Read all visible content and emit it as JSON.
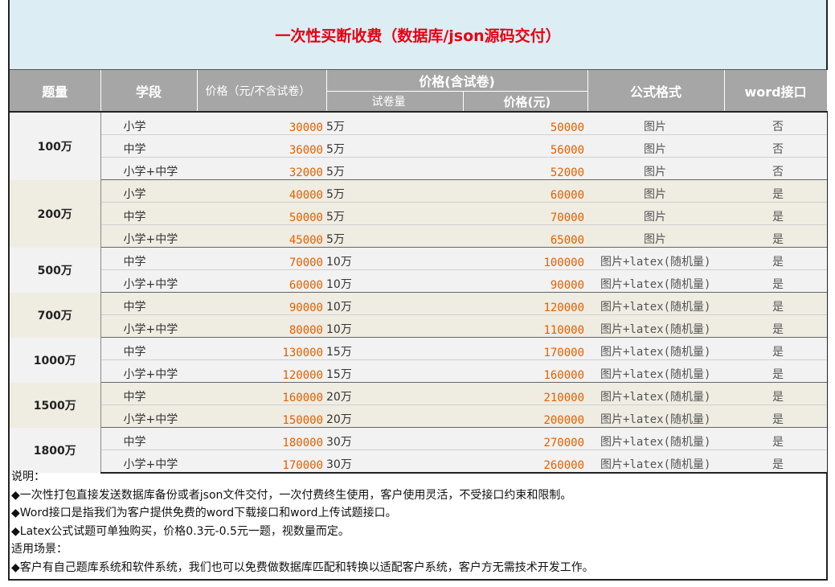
{
  "title": "一次性买断收费（数据库/json源码交付）",
  "headers": {
    "qty": "题量",
    "stage": "学段",
    "price_ex": "价格（元/不含试卷）",
    "price_inc": "价格(含试卷)",
    "papers": "试卷量",
    "price": "价格(元)",
    "formula": "公式格式",
    "word": "word接口"
  },
  "groups": [
    {
      "qty": "100万",
      "rows": [
        {
          "stage": "小学",
          "p1": "30000",
          "cnt": "5万",
          "p2": "50000",
          "fmt": "图片",
          "word": "否"
        },
        {
          "stage": "中学",
          "p1": "36000",
          "cnt": "5万",
          "p2": "56000",
          "fmt": "图片",
          "word": "否"
        },
        {
          "stage": "小学+中学",
          "p1": "32000",
          "cnt": "5万",
          "p2": "52000",
          "fmt": "图片",
          "word": "否"
        }
      ]
    },
    {
      "qty": "200万",
      "rows": [
        {
          "stage": "小学",
          "p1": "40000",
          "cnt": "5万",
          "p2": "60000",
          "fmt": "图片",
          "word": "是"
        },
        {
          "stage": "中学",
          "p1": "50000",
          "cnt": "5万",
          "p2": "70000",
          "fmt": "图片",
          "word": "是"
        },
        {
          "stage": "小学+中学",
          "p1": "45000",
          "cnt": "5万",
          "p2": "65000",
          "fmt": "图片",
          "word": "是"
        }
      ]
    },
    {
      "qty": "500万",
      "rows": [
        {
          "stage": "中学",
          "p1": "70000",
          "cnt": "10万",
          "p2": "100000",
          "fmt": "图片+latex(随机量)",
          "word": "是"
        },
        {
          "stage": "小学+中学",
          "p1": "60000",
          "cnt": "10万",
          "p2": "90000",
          "fmt": "图片+latex(随机量)",
          "word": "是"
        }
      ]
    },
    {
      "qty": "700万",
      "rows": [
        {
          "stage": "中学",
          "p1": "90000",
          "cnt": "10万",
          "p2": "120000",
          "fmt": "图片+latex(随机量)",
          "word": "是"
        },
        {
          "stage": "小学+中学",
          "p1": "80000",
          "cnt": "10万",
          "p2": "110000",
          "fmt": "图片+latex(随机量)",
          "word": "是"
        }
      ]
    },
    {
      "qty": "1000万",
      "rows": [
        {
          "stage": "中学",
          "p1": "130000",
          "cnt": "15万",
          "p2": "170000",
          "fmt": "图片+latex(随机量)",
          "word": "是"
        },
        {
          "stage": "小学+中学",
          "p1": "120000",
          "cnt": "15万",
          "p2": "160000",
          "fmt": "图片+latex(随机量)",
          "word": "是"
        }
      ]
    },
    {
      "qty": "1500万",
      "rows": [
        {
          "stage": "中学",
          "p1": "160000",
          "cnt": "20万",
          "p2": "210000",
          "fmt": "图片+latex(随机量)",
          "word": "是"
        },
        {
          "stage": "小学+中学",
          "p1": "150000",
          "cnt": "20万",
          "p2": "200000",
          "fmt": "图片+latex(随机量)",
          "word": "是"
        }
      ]
    },
    {
      "qty": "1800万",
      "rows": [
        {
          "stage": "中学",
          "p1": "180000",
          "cnt": "30万",
          "p2": "270000",
          "fmt": "图片+latex(随机量)",
          "word": "是"
        },
        {
          "stage": "小学+中学",
          "p1": "170000",
          "cnt": "30万",
          "p2": "260000",
          "fmt": "图片+latex(随机量)",
          "word": "是"
        }
      ]
    }
  ],
  "notes": [
    "说明：",
    "◆一次性打包直接发送数据库备份或者json文件交付，一次付费终生使用，客户使用灵活，不受接口约束和限制。",
    "◆Word接口是指我们为客户提供免费的word下载接口和word上传试题接口。",
    "◆Latex公式试题可单独购买，价格0.3元-0.5元一题，视数量而定。",
    "适用场景：",
    "◆客户有自己题库系统和软件系统，我们也可以免费做数据库匹配和转换以适配客户系统，客户方无需技术开发工作。"
  ]
}
